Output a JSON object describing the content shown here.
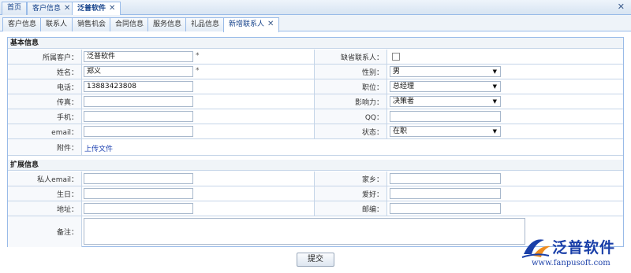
{
  "top_tabs": [
    {
      "label": "首页",
      "closable": false
    },
    {
      "label": "客户信息",
      "closable": true
    },
    {
      "label": "泛普软件",
      "closable": true
    }
  ],
  "sub_tabs": [
    {
      "label": "客户信息"
    },
    {
      "label": "联系人"
    },
    {
      "label": "销售机会"
    },
    {
      "label": "合同信息"
    },
    {
      "label": "服务信息"
    },
    {
      "label": "礼品信息"
    },
    {
      "label": "新增联系人",
      "closable": true
    }
  ],
  "basic": {
    "title": "基本信息",
    "customer_label": "所属客户：",
    "customer_value": "泛普软件",
    "required_star": "*",
    "default_contact_label": "缺省联系人：",
    "name_label": "姓名：",
    "name_value": "郑义",
    "gender_label": "性别：",
    "gender_value": "男",
    "phone_label": "电话：",
    "phone_value": "13883423808",
    "position_label": "职位：",
    "position_value": "总经理",
    "fax_label": "传真：",
    "influence_label": "影响力：",
    "influence_value": "决策者",
    "mobile_label": "手机：",
    "qq_label": "QQ：",
    "email_label": "email：",
    "status_label": "状态：",
    "status_value": "在职",
    "attachment_label": "附件：",
    "upload_link": "上传文件"
  },
  "extended": {
    "title": "扩展信息",
    "private_email_label": "私人email：",
    "hometown_label": "家乡：",
    "birthday_label": "生日：",
    "hobby_label": "爱好：",
    "address_label": "地址：",
    "zipcode_label": "邮编：",
    "remark_label": "备注："
  },
  "submit_label": "提交",
  "logo": {
    "name": "泛普软件",
    "url": "www.fanpusoft.com"
  },
  "colors": {
    "border": "#99bbe8",
    "accent": "#1a3fa8",
    "logo_orange": "#f08c1e"
  }
}
